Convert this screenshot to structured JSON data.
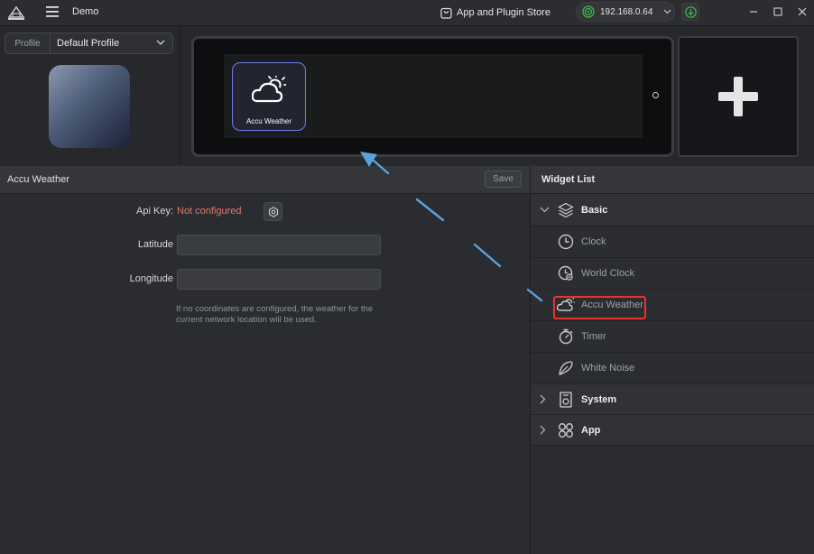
{
  "titlebar": {
    "app_title": "Demo",
    "store_label": "App and Plugin Store",
    "device_ip": "192.168.0.64"
  },
  "profile": {
    "label": "Profile",
    "selected": "Default Profile"
  },
  "device": {
    "widget_label": "Accu Weather"
  },
  "properties": {
    "title": "Accu Weather",
    "save_label": "Save",
    "api_key_label": "Api Key:",
    "api_key_value": "Not configured",
    "latitude_label": "Latitude",
    "latitude_value": "",
    "longitude_label": "Longitude",
    "longitude_value": "",
    "hint": "If no coordinates are configured, the weather for the current network location will be used."
  },
  "widget_list": {
    "title": "Widget List",
    "groups": [
      {
        "label": "Basic",
        "expanded": true,
        "items": [
          {
            "label": "Clock",
            "icon": "clock-icon"
          },
          {
            "label": "World Clock",
            "icon": "world-clock-icon"
          },
          {
            "label": "Accu Weather",
            "icon": "weather-icon",
            "highlighted": true
          },
          {
            "label": "Timer",
            "icon": "timer-icon"
          },
          {
            "label": "White Noise",
            "icon": "white-noise-icon"
          }
        ]
      },
      {
        "label": "System",
        "expanded": false,
        "icon": "system-icon"
      },
      {
        "label": "App",
        "expanded": false,
        "icon": "app-grid-icon"
      }
    ]
  },
  "colors": {
    "accent_blue": "#6f7cf0",
    "highlight_red": "#e8322e",
    "error_text": "#e07a6e",
    "online_green": "#3fb950",
    "arrow_blue": "#5aa2dc"
  }
}
